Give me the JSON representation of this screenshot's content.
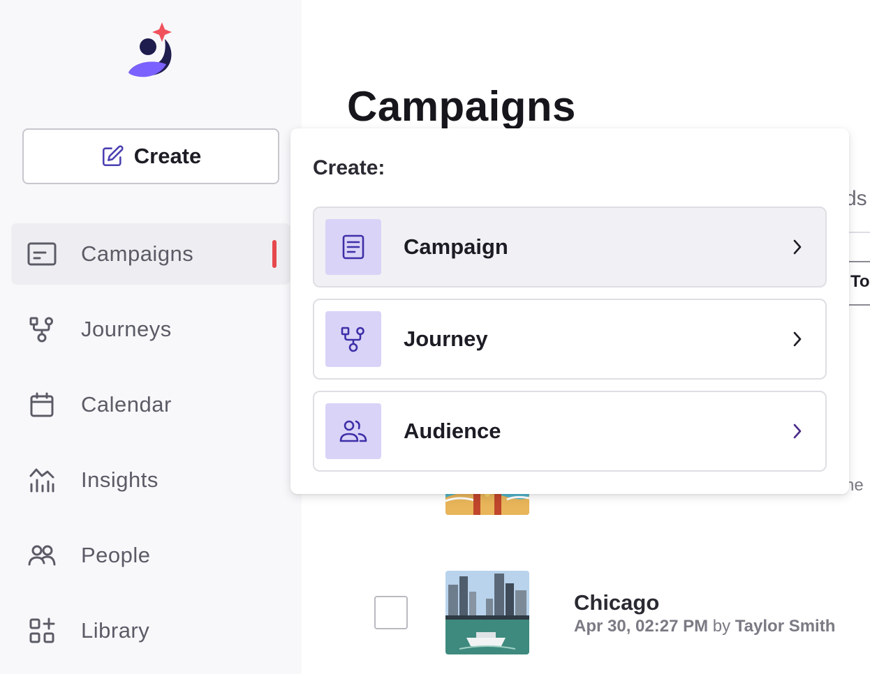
{
  "colors": {
    "sidebar_bg": "#f8f8fb",
    "active_bar": "#e5484d",
    "brand_purple": "#7b61ff",
    "logo_navy": "#1f1d4e",
    "logo_star": "#f0525c",
    "option_icon_bg": "#d9d3f7",
    "option_icon_fg": "#3d2fa8"
  },
  "sidebar": {
    "create_label": "Create",
    "create_icon": "edit-icon",
    "items": [
      {
        "label": "Campaigns",
        "icon": "campaign-card-icon",
        "active": true
      },
      {
        "label": "Journeys",
        "icon": "flow-branch-icon"
      },
      {
        "label": "Calendar",
        "icon": "calendar-icon"
      },
      {
        "label": "Insights",
        "icon": "chart-icon"
      },
      {
        "label": "People",
        "icon": "people-icon"
      },
      {
        "label": "Library",
        "icon": "library-icon"
      }
    ]
  },
  "main": {
    "title": "Campaigns",
    "partial_tab_text": "ds",
    "partial_column_text": "To",
    "partial_row_text": "ne",
    "rows": [
      {
        "title": "Chicago",
        "date": "Apr 30, 02:27 PM",
        "by": "by",
        "author": "Taylor Smith"
      }
    ]
  },
  "dropdown": {
    "heading": "Create:",
    "options": [
      {
        "label": "Campaign",
        "icon": "document-icon"
      },
      {
        "label": "Journey",
        "icon": "flow-branch-icon"
      },
      {
        "label": "Audience",
        "icon": "audience-icon"
      }
    ]
  }
}
